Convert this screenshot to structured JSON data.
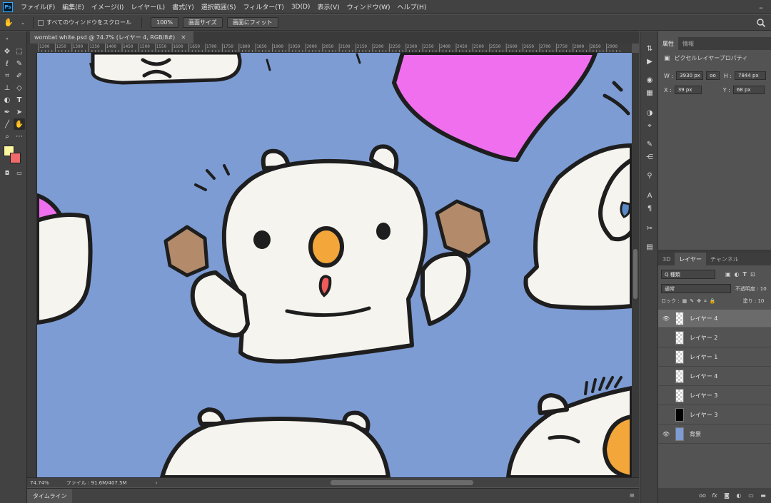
{
  "menubar": {
    "items": [
      "ファイル(F)",
      "編集(E)",
      "イメージ(I)",
      "レイヤー(L)",
      "書式(Y)",
      "選択範囲(S)",
      "フィルター(T)",
      "3D(D)",
      "表示(V)",
      "ウィンドウ(W)",
      "ヘルプ(H)"
    ],
    "logo": "Ps"
  },
  "options": {
    "scroll_all_label": "すべてのウィンドウをスクロール",
    "zoom_btn": "100%",
    "fit_screen_btn": "画面サイズ",
    "fill_screen_btn": "画面にフィット"
  },
  "document": {
    "tab_title": "wombat white.psd @ 74.7% (レイヤー 4, RGB/8#)",
    "close": "×"
  },
  "ruler_ticks": [
    "1200",
    "1250",
    "1300",
    "1350",
    "1400",
    "1450",
    "1500",
    "1550",
    "1600",
    "1650",
    "1700",
    "1750",
    "1800",
    "1850",
    "1900",
    "1950",
    "2000",
    "2050",
    "2100",
    "2150",
    "2200",
    "2250",
    "2300",
    "2350",
    "2400",
    "2450",
    "2500",
    "2550",
    "2600",
    "2650",
    "2700",
    "2750",
    "2800",
    "2850",
    "2900"
  ],
  "statusbar": {
    "zoom": "74.74%",
    "file_info": "ファイル : 91.6M/407.5M",
    "arrow": "›"
  },
  "timeline": {
    "label": "タイムライン"
  },
  "properties": {
    "tabs": [
      "属性",
      "情報"
    ],
    "title": "ピクセルレイヤープロパティ",
    "w_label": "W :",
    "w_value": "3930 px",
    "h_label": "H :",
    "h_value": "7844 px",
    "x_label": "X :",
    "x_value": "39 px",
    "y_label": "Y :",
    "y_value": "68 px",
    "link": "oo"
  },
  "layers": {
    "tabs": [
      "3D",
      "レイヤー",
      "チャンネル"
    ],
    "filter_kind": "Q 種類",
    "blend_mode": "通常",
    "opacity_label": "不透明度 : 10",
    "lock_label": "ロック :",
    "fill_label": "塗り : 10",
    "items": [
      {
        "name": "レイヤー 4",
        "visible": true,
        "selected": true,
        "thumb": "checker"
      },
      {
        "name": "レイヤー 2",
        "visible": false,
        "selected": false,
        "thumb": "checker"
      },
      {
        "name": "レイヤー 1",
        "visible": false,
        "selected": false,
        "thumb": "checker"
      },
      {
        "name": "レイヤー 4",
        "visible": false,
        "selected": false,
        "thumb": "checker"
      },
      {
        "name": "レイヤー 3",
        "visible": false,
        "selected": false,
        "thumb": "checker"
      },
      {
        "name": "レイヤー 3",
        "visible": false,
        "selected": false,
        "thumb": "black"
      },
      {
        "name": "背景",
        "visible": true,
        "selected": false,
        "thumb": "blue"
      }
    ]
  },
  "colors": {
    "foreground": "#fdf6a0",
    "background": "#ef6a6a",
    "canvas_bg": "#7d9cd4"
  }
}
